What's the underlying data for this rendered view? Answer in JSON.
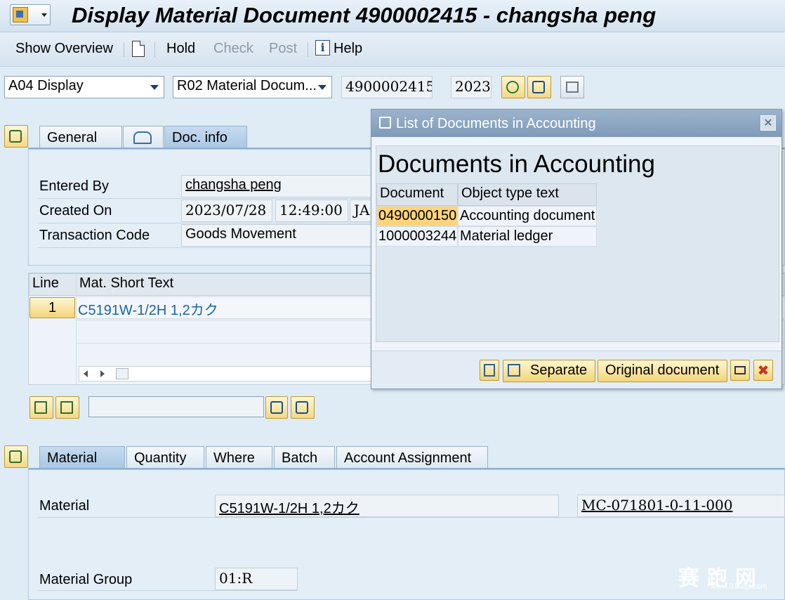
{
  "window": {
    "title": "Display Material Document 4900002415 - changsha peng"
  },
  "toolbar": {
    "show_overview": "Show Overview",
    "hold": "Hold",
    "check": "Check",
    "post": "Post",
    "help": "Help"
  },
  "header_controls": {
    "action": "A04 Display",
    "reference": "R02 Material Docum...",
    "doc_number": "4900002415",
    "year": "2023"
  },
  "header_tabs": {
    "general": "General",
    "doc_info": "Doc. info"
  },
  "doc_info": {
    "entered_by_label": "Entered By",
    "entered_by": "changsha peng",
    "created_on_label": "Created On",
    "created_date": "2023/07/28",
    "created_time": "12:49:00",
    "created_extra": "JA",
    "tcode_label": "Transaction Code",
    "tcode_value": "Goods Movement"
  },
  "items_table": {
    "headers": [
      "Line",
      "Mat. Short Text"
    ],
    "rows": [
      {
        "line": "1",
        "text": "C5191W-1/2H 1,2カク"
      }
    ]
  },
  "detail_tabs": [
    "Material",
    "Quantity",
    "Where",
    "Batch",
    "Account Assignment"
  ],
  "detail": {
    "material_label": "Material",
    "material_value": "C5191W-1/2H 1,2カク",
    "material_code": "MC-071801-0-11-000",
    "group_label": "Material Group",
    "group_value": "01:R"
  },
  "popup": {
    "title": "List of Documents in Accounting",
    "heading": "Documents in Accounting",
    "columns": [
      "Document",
      "Object type text"
    ],
    "rows": [
      {
        "doc": "0490000150",
        "type": "Accounting document"
      },
      {
        "doc": "1000003244",
        "type": "Material ledger"
      }
    ],
    "separate": "Separate",
    "original": "Original document"
  },
  "watermark": {
    "text": "赛 跑 网",
    "sub": "www.915ap.com"
  },
  "colors": {
    "accent": "#f4d985",
    "popup_title": "#8ea7c3",
    "tab_active": "#b6d0e9"
  }
}
